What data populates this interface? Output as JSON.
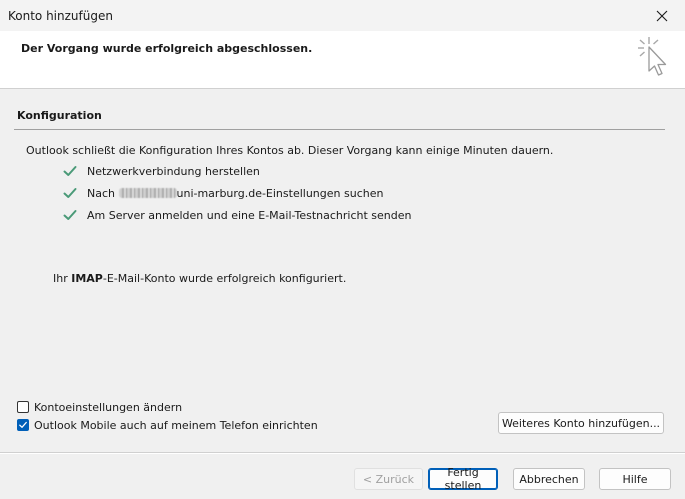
{
  "window": {
    "title": "Konto hinzufügen",
    "close_icon": "close-icon"
  },
  "header": {
    "message": "Der Vorgang wurde erfolgreich abgeschlossen.",
    "icon": "wizard-cursor-sparkle-icon"
  },
  "config": {
    "section_title": "Konfiguration",
    "intro": "Outlook schließt die Konfiguration Ihres Kontos ab. Dieser Vorgang kann einige Minuten dauern.",
    "steps": [
      {
        "label": "Netzwerkverbindung herstellen",
        "status": "done"
      },
      {
        "label_prefix": "Nach ",
        "label_suffix": "uni-marburg.de-Einstellungen suchen",
        "status": "done"
      },
      {
        "label": "Am Server anmelden und eine E-Mail-Testnachricht senden",
        "status": "done"
      }
    ],
    "result_prefix": "Ihr ",
    "result_bold": "IMAP",
    "result_suffix": "-E-Mail-Konto wurde erfolgreich konfiguriert."
  },
  "options": {
    "change_settings": {
      "label": "Kontoeinstellungen ändern",
      "checked": false
    },
    "outlook_mobile": {
      "label": "Outlook Mobile auch auf meinem Telefon einrichten",
      "checked": true
    },
    "add_another": "Weiteres Konto hinzufügen..."
  },
  "footer": {
    "back": "< Zurück",
    "finish": "Fertig stellen",
    "cancel": "Abbrechen",
    "help": "Hilfe"
  },
  "colors": {
    "check_green": "#4a9a78",
    "accent": "#005fb8"
  }
}
